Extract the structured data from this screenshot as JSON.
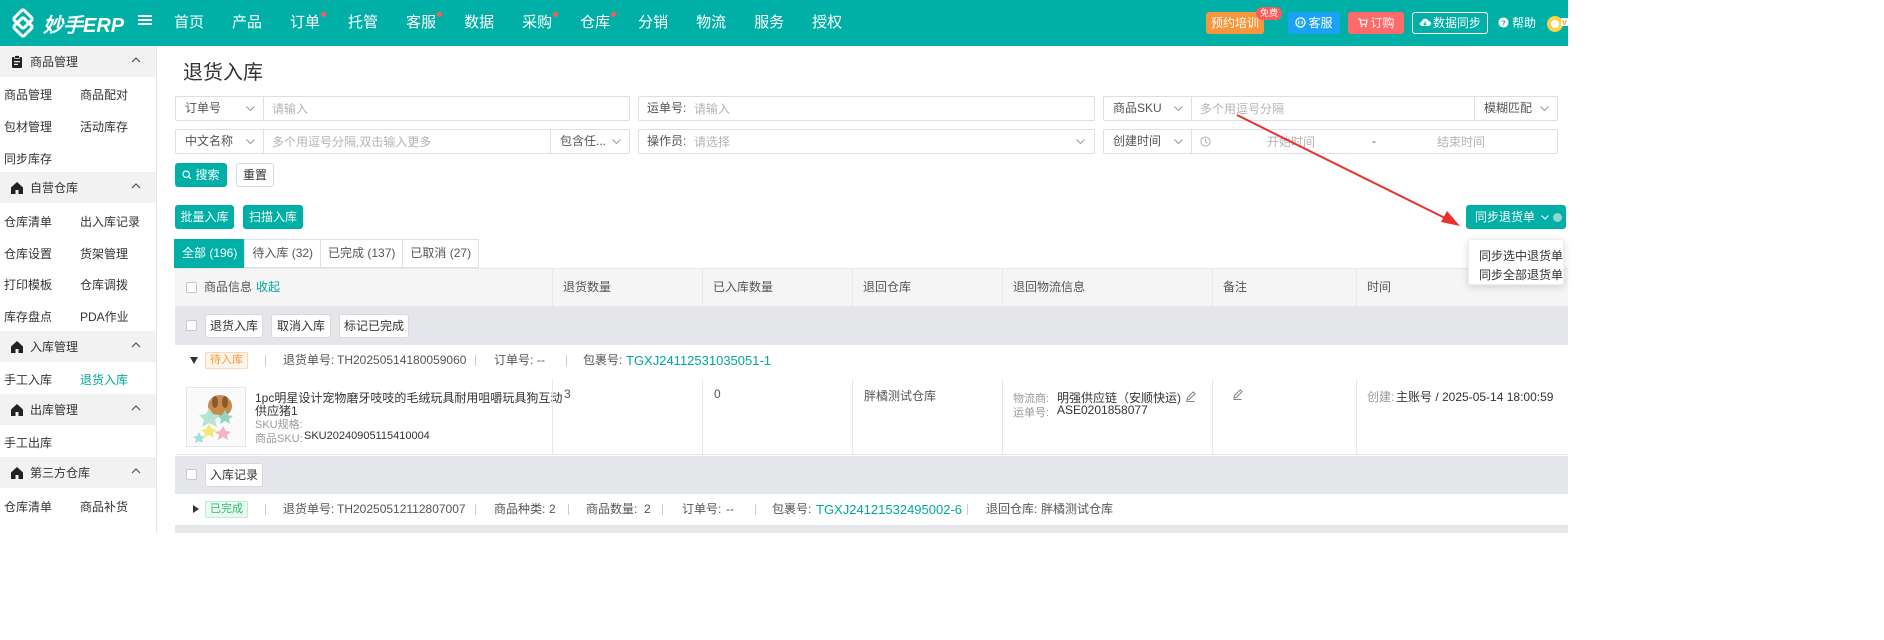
{
  "brand": {
    "name": "妙手ERP"
  },
  "nav": [
    {
      "label": "首页",
      "dot": false
    },
    {
      "label": "产品",
      "dot": false
    },
    {
      "label": "订单",
      "dot": true
    },
    {
      "label": "托管",
      "dot": false
    },
    {
      "label": "客服",
      "dot": true
    },
    {
      "label": "数据",
      "dot": false
    },
    {
      "label": "采购",
      "dot": true
    },
    {
      "label": "仓库",
      "dot": true
    },
    {
      "label": "分销",
      "dot": false
    },
    {
      "label": "物流",
      "dot": false
    },
    {
      "label": "服务",
      "dot": false
    },
    {
      "label": "授权",
      "dot": false
    }
  ],
  "top_actions": {
    "training": "预约培训",
    "training_badge": "免费",
    "service": "客服",
    "order": "订购",
    "sync": "数据同步",
    "help": "帮助"
  },
  "sidebar": {
    "sections": [
      {
        "title": "商品管理",
        "links": [
          "商品管理",
          "商品配对",
          "包材管理",
          "活动库存",
          "同步库存"
        ]
      },
      {
        "title": "自营仓库",
        "links": [
          "仓库清单",
          "出入库记录",
          "仓库设置",
          "货架管理",
          "打印模板",
          "仓库调拨",
          "库存盘点",
          "PDA作业"
        ]
      },
      {
        "title": "入库管理",
        "links": [
          "手工入库",
          "退货入库"
        ]
      },
      {
        "title": "出库管理",
        "links": [
          "手工出库"
        ]
      },
      {
        "title": "第三方仓库",
        "links": [
          "仓库清单",
          "商品补货"
        ]
      }
    ]
  },
  "page": {
    "title": "退货入库"
  },
  "filters": {
    "order_no_label": "订单号",
    "order_no_placeholder": "请输入",
    "waybill_label": "运单号:",
    "waybill_placeholder": "请输入",
    "sku_label": "商品SKU",
    "sku_placeholder": "多个用逗号分隔",
    "match_mode": "模糊匹配",
    "name_label": "中文名称",
    "name_placeholder": "多个用逗号分隔,双击输入更多",
    "contains_label": "包含任...",
    "operator_label": "操作员:",
    "operator_placeholder": "请选择",
    "time_label": "创建时间",
    "start_placeholder": "开始时间",
    "range_sep": "-",
    "end_placeholder": "结束时间"
  },
  "buttons": {
    "search": "搜索",
    "reset": "重置",
    "batch_in": "批量入库",
    "scan_in": "扫描入库",
    "sync_returns": "同步退货单"
  },
  "sync_menu": [
    "同步选中退货单",
    "同步全部退货单"
  ],
  "tabs": [
    {
      "label": "全部 (196)",
      "active": true
    },
    {
      "label": "待入库 (32)",
      "active": false
    },
    {
      "label": "已完成 (137)",
      "active": false
    },
    {
      "label": "已取消 (27)",
      "active": false
    }
  ],
  "table": {
    "headers": {
      "product": "商品信息",
      "collapse": "收起",
      "return_qty": "退货数量",
      "stocked_qty": "已入库数量",
      "warehouse": "退回仓库",
      "logistics": "退回物流信息",
      "remark": "备注",
      "time": "时间"
    }
  },
  "group1": {
    "actions": [
      "退货入库",
      "取消入库",
      "标记已完成"
    ],
    "status": "待入库",
    "return_no_label": "退货单号:",
    "return_no": "TH20250514180059060",
    "order_no_label": "订单号:",
    "order_no": "--",
    "package_no_label": "包裹号:",
    "package_no": "TGXJ24112531035051-1",
    "item": {
      "title_line1": "1pc明星设计宠物磨牙吱吱的毛绒玩具耐用咀嚼玩具狗互动",
      "title_line2": "供应猪1",
      "sku_spec_label": "SKU规格:",
      "sku_label": "商品SKU:",
      "sku": "SKU20240905115410004",
      "return_qty": "3",
      "stocked_qty": "0",
      "warehouse": "胖橘测试仓库",
      "carrier_label": "物流商:",
      "carrier": "明强供应链（安顺快运)",
      "waybill_label": "运单号:",
      "waybill": "ASE0201858077",
      "time_label": "创建:",
      "time_value": "主账号 / 2025-05-14 18:00:59"
    }
  },
  "group2": {
    "actions": [
      "入库记录"
    ],
    "status": "已完成",
    "return_no_label": "退货单号:",
    "return_no": "TH20250512112807007",
    "kinds_label": "商品种类:",
    "kinds": "2",
    "qty_label": "商品数量:",
    "qty": "2",
    "order_no_label": "订单号:",
    "order_no": "--",
    "package_no_label": "包裹号:",
    "package_no": "TGXJ24121532495002-6",
    "warehouse_label": "退回仓库:",
    "warehouse": "胖橘测试仓库"
  },
  "colors": {
    "brand": "#00b0a6",
    "link": "#00a89b",
    "orange": "#f7963a",
    "red": "#ff5a5a",
    "blue": "#1aa3f5",
    "annotation_arrow": "#e8322e"
  }
}
